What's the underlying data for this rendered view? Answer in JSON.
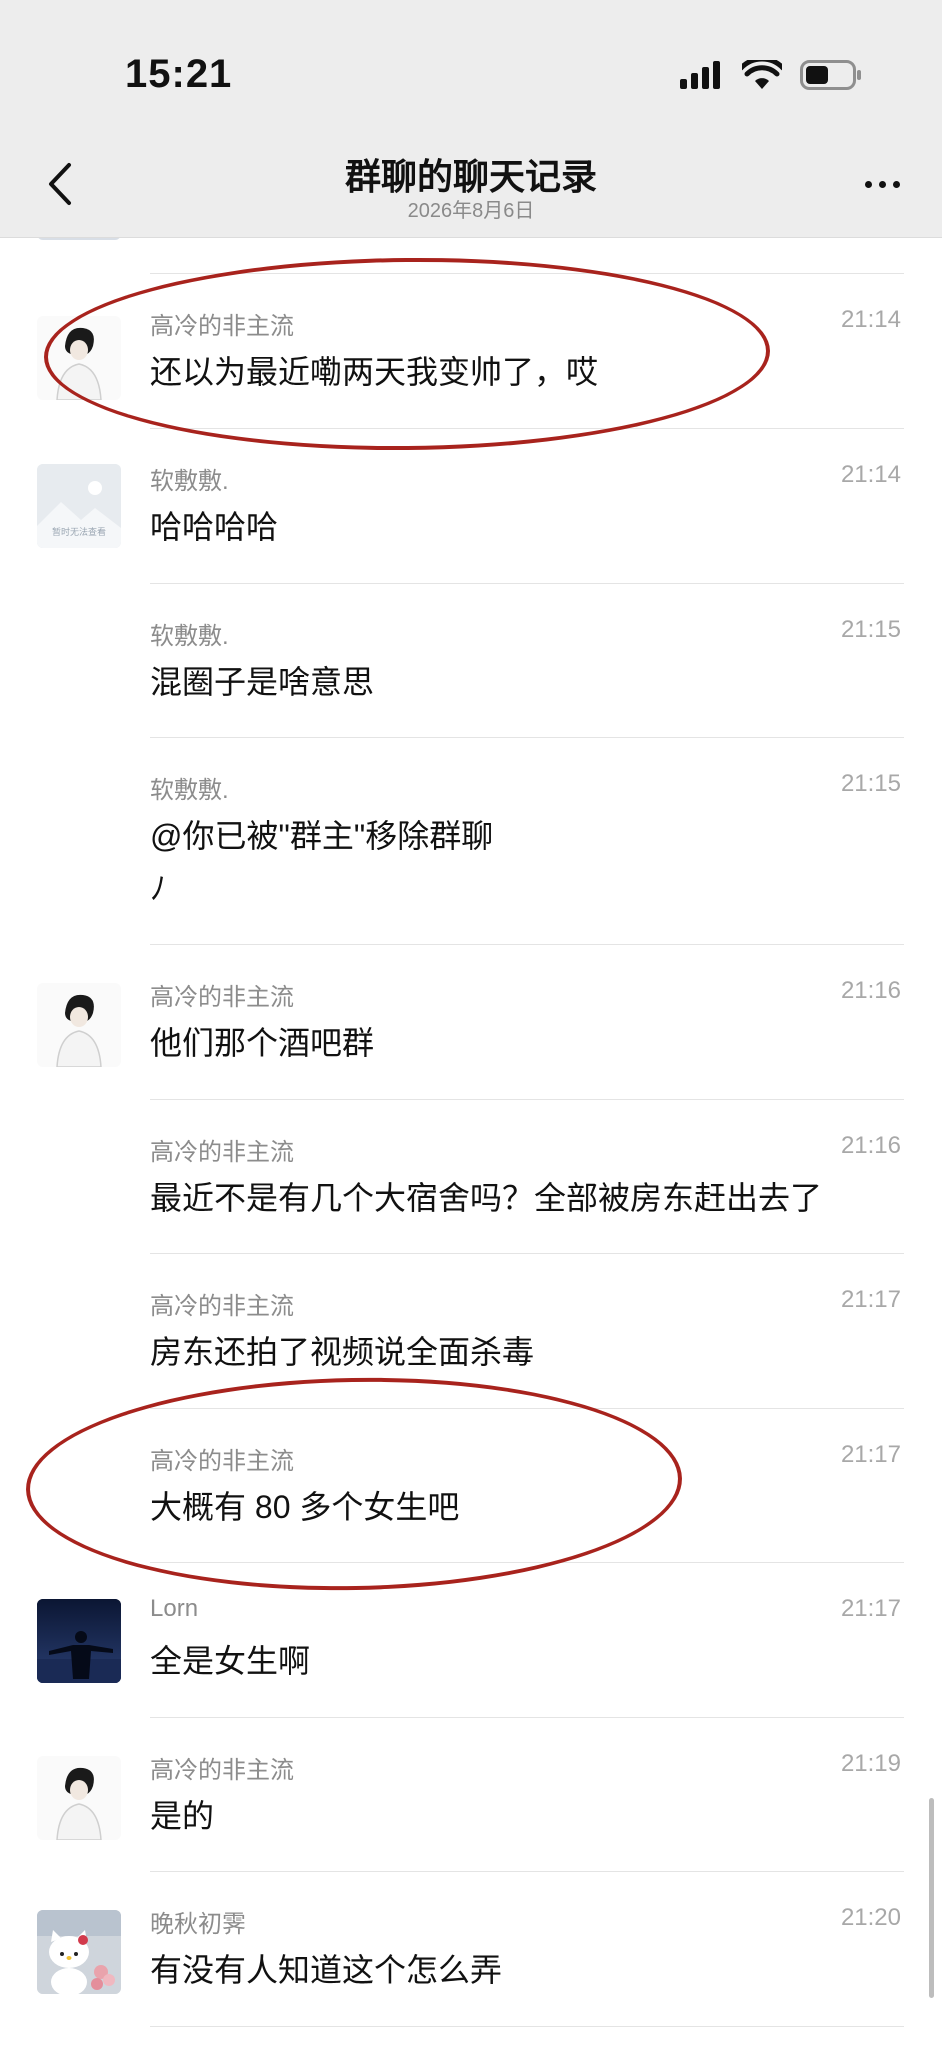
{
  "status_bar": {
    "time": "15:21"
  },
  "nav": {
    "title": "群聊的聊天记录",
    "subtitle": "2026年8月6日"
  },
  "messages": [
    {
      "sender": "高冷的非主流",
      "time": "21:14",
      "text": "还以为最近嘞两天我变帅了，哎",
      "avatar": "boy-sketch"
    },
    {
      "sender": "软敷敷.",
      "time": "21:14",
      "text": "哈哈哈哈",
      "avatar": "placeholder-landscape",
      "avatar_caption": "暂时无法查看"
    },
    {
      "sender": "软敷敷.",
      "time": "21:15",
      "text": "混圈子是啥意思"
    },
    {
      "sender": "软敷敷.",
      "time": "21:15",
      "text": "@你已被\"群主\"移除群聊",
      "text2": "ﾉ"
    },
    {
      "sender": "高冷的非主流",
      "time": "21:16",
      "text": "他们那个酒吧群",
      "avatar": "boy-sketch"
    },
    {
      "sender": "高冷的非主流",
      "time": "21:16",
      "text": "最近不是有几个大宿舍吗？全部被房东赶出去了"
    },
    {
      "sender": "高冷的非主流",
      "time": "21:17",
      "text": "房东还拍了视频说全面杀毒"
    },
    {
      "sender": "高冷的非主流",
      "time": "21:17",
      "text": "大概有 80 多个女生吧"
    },
    {
      "sender": "Lorn",
      "time": "21:17",
      "text": "全是女生啊",
      "avatar": "night-silhouette"
    },
    {
      "sender": "高冷的非主流",
      "time": "21:19",
      "text": "是的",
      "avatar": "boy-sketch"
    },
    {
      "sender": "晚秋初霁",
      "time": "21:20",
      "text": "有没有人知道这个怎么弄",
      "avatar": "hello-kitty-plush"
    }
  ],
  "colors": {
    "annotation": "#a8231d",
    "nav_bg": "#ededed"
  }
}
